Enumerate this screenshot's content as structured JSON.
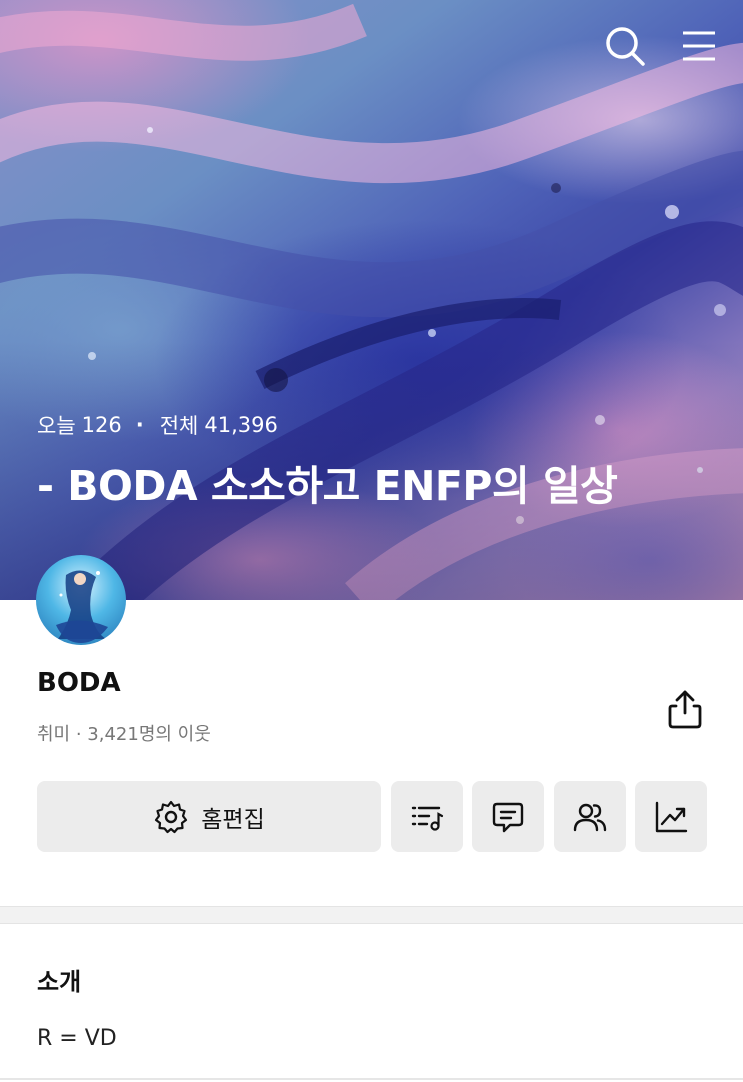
{
  "header": {
    "search_icon": "search-icon",
    "menu_icon": "menu-icon"
  },
  "stats": {
    "today_label": "오늘",
    "today_count": "126",
    "separator": "·",
    "total_label": "전체",
    "total_count": "41,396"
  },
  "blog": {
    "title": "- BODA 소소하고 ENFP의 일상"
  },
  "profile": {
    "name": "BODA",
    "meta": "취미 · 3,421명의 이웃"
  },
  "actions": {
    "edit_label": "홈편집",
    "edit_icon": "gear-icon",
    "buttons": [
      "playlist-icon",
      "comment-icon",
      "neighbors-icon",
      "stats-icon"
    ]
  },
  "intro": {
    "heading": "소개",
    "text": "R = VD"
  },
  "colors": {
    "button_bg": "#ececec",
    "divider_bg": "#f2f2f2",
    "meta_text": "#777777"
  }
}
